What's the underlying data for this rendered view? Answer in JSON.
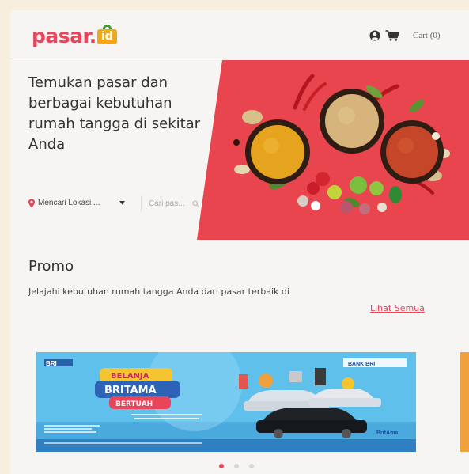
{
  "header": {
    "logo_word": "pasar.",
    "logo_badge": "id",
    "cart_label": "Cart (0)"
  },
  "hero": {
    "title": "Temukan pasar dan berbagai kebutuhan rumah tangga di sekitar Anda",
    "location_label": "Mencari Lokasi ...",
    "search_placeholder": "Cari pas..."
  },
  "promo": {
    "title": "Promo",
    "description": "Jelajahi kebutuhan rumah tangga Anda dari pasar terbaik di",
    "see_all_label": "Lihat Semua",
    "banner": {
      "left_brand": "BRI",
      "headline_top": "BELANJA",
      "headline_mid": "BRITAMA",
      "headline_bot": "BERTUAH",
      "right_brand": "BANK BRI",
      "footer_brand": "BritAma"
    },
    "carousel": {
      "total_slides": 3,
      "active_slide": 1
    }
  },
  "colors": {
    "brand": "#e8455b",
    "hero_red": "#e8454f",
    "logo_bag": "#f1a61c",
    "banner_blue": "#57b9e6"
  }
}
